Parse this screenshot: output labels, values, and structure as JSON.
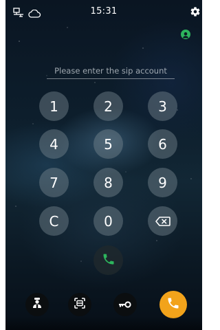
{
  "status_bar": {
    "time": "15:31",
    "network_icon": "network-icon",
    "cloud_icon": "cloud-icon",
    "settings_icon": "gear-icon"
  },
  "account": {
    "icon": "person-icon",
    "color": "#2db55d"
  },
  "sip_input": {
    "value": "",
    "placeholder": "Please enter the sip account"
  },
  "keypad": {
    "keys": [
      "1",
      "2",
      "3",
      "4",
      "5",
      "6",
      "7",
      "8",
      "9",
      "C",
      "0"
    ],
    "backspace_icon": "backspace-icon",
    "call_icon": "phone-icon",
    "call_color": "#2db55d"
  },
  "bottom_bar": {
    "buttons": [
      {
        "icon": "doorman-icon"
      },
      {
        "icon": "scan-icon"
      },
      {
        "icon": "key-icon"
      },
      {
        "icon": "phone-icon",
        "color": "#f2a31b"
      }
    ]
  }
}
